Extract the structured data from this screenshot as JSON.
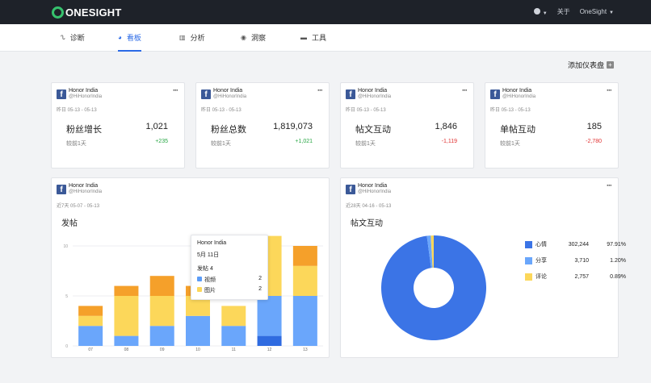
{
  "app": {
    "logo_text": "ONESIGHT"
  },
  "topbar": {
    "about": "关于",
    "account": "OneSight"
  },
  "nav": {
    "items": [
      {
        "label": "诊断",
        "icon": "stethoscope-icon"
      },
      {
        "label": "看板",
        "icon": "dashboard-icon",
        "active": true
      },
      {
        "label": "分析",
        "icon": "bar-chart-icon"
      },
      {
        "label": "洞察",
        "icon": "eye-icon"
      },
      {
        "label": "工具",
        "icon": "toolbox-icon"
      }
    ]
  },
  "toolbar": {
    "add_dashboard": "添加仪表盘"
  },
  "cards": [
    {
      "account": "Honor India",
      "handle": "@HiHonorIndia",
      "date": "昨日 05-13 - 05-13",
      "title": "粉丝增长",
      "value": "1,021",
      "compare_label": "较前1天",
      "delta": "+235",
      "delta_dir": "pos"
    },
    {
      "account": "Honor India",
      "handle": "@HiHonorIndia",
      "date": "昨日 05-13 - 05-13",
      "title": "粉丝总数",
      "value": "1,819,073",
      "compare_label": "较前1天",
      "delta": "+1,021",
      "delta_dir": "pos"
    },
    {
      "account": "Honor India",
      "handle": "@HiHonorIndia",
      "date": "昨日 05-13 - 05-13",
      "title": "帖文互动",
      "value": "1,846",
      "compare_label": "较前1天",
      "delta": "-1,119",
      "delta_dir": "neg"
    },
    {
      "account": "Honor India",
      "handle": "@HiHonorIndia",
      "date": "昨日 05-13 - 05-13",
      "title": "单帖互动",
      "value": "185",
      "compare_label": "较前1天",
      "delta": "-2,780",
      "delta_dir": "neg"
    }
  ],
  "panels": {
    "posts": {
      "account": "Honor India",
      "handle": "@HiHonorIndia",
      "date": "近7天 05-07 - 05-13",
      "title": "发帖"
    },
    "engagement": {
      "account": "Honor India",
      "handle": "@HiHonorIndia",
      "date": "近28天 04-16 - 05-13",
      "title": "帖文互动"
    }
  },
  "tooltip": {
    "account": "Honor India",
    "date": "5月 11日",
    "total_label": "发帖 4",
    "rows": [
      {
        "label": "视频",
        "value": "2",
        "color": "#5b9cf7"
      },
      {
        "label": "图片",
        "value": "2",
        "color": "#fcd75a"
      }
    ]
  },
  "colors": {
    "accent": "#2b6ae6",
    "dark_blue": "#2f6be0",
    "light_blue": "#6aa6fb",
    "yellow": "#fcd75a",
    "orange": "#f5a02a"
  },
  "chart_data": [
    {
      "type": "bar",
      "stacked": true,
      "title": "发帖",
      "categories": [
        "07",
        "08",
        "09",
        "10",
        "11",
        "12",
        "13"
      ],
      "ylim": [
        0,
        10
      ],
      "yticks": [
        0,
        5,
        10
      ],
      "series": [
        {
          "color": "#2f6be0",
          "values": [
            0,
            0,
            0,
            0,
            0,
            1,
            0
          ]
        },
        {
          "color": "#6aa6fb",
          "values": [
            2,
            1,
            2,
            3,
            2,
            4,
            5
          ]
        },
        {
          "color": "#fcd75a",
          "values": [
            1,
            4,
            3,
            2,
            2,
            6,
            3
          ]
        },
        {
          "color": "#f5a02a",
          "values": [
            1,
            1,
            2,
            1,
            0,
            0,
            2
          ]
        }
      ]
    },
    {
      "type": "pie",
      "donut": true,
      "title": "帖文互动",
      "legend_position": "right",
      "slices": [
        {
          "label": "心情",
          "value": 302244,
          "value_text": "302,244",
          "percent_text": "97.91%",
          "color": "#3b74e6"
        },
        {
          "label": "分享",
          "value": 3710,
          "value_text": "3,710",
          "percent_text": "1.20%",
          "color": "#6aa6fb"
        },
        {
          "label": "评论",
          "value": 2757,
          "value_text": "2,757",
          "percent_text": "0.89%",
          "color": "#fcd75a"
        }
      ]
    }
  ]
}
